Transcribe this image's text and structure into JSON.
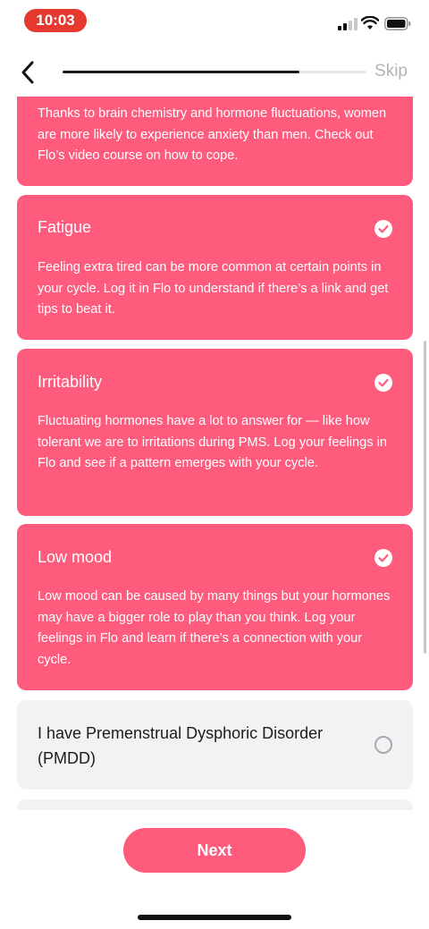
{
  "status_bar": {
    "time": "10:03",
    "icons": [
      "signal-icon",
      "wifi-icon",
      "battery-icon"
    ],
    "time_pill_color": "#e5392f"
  },
  "nav": {
    "back_icon": "back-chevron-icon",
    "skip_label": "Skip",
    "progress": 0.78
  },
  "cards": [
    {
      "title": "",
      "description": "Thanks to brain chemistry and hormone fluctuations, women are more likely to experience anxiety than men. Check out Flo’s video course on how to cope.",
      "selected": true
    },
    {
      "title": "Fatigue",
      "description": "Feeling extra tired can be more common at certain points in your cycle. Log it in Flo to understand if there’s a link and get tips to beat it.",
      "selected": true
    },
    {
      "title": "Irritability",
      "description": "Fluctuating hormones have a lot to answer for — like how tolerant we are to irritations during PMS. Log your feelings in Flo and see if a pattern emerges with your cycle.",
      "selected": true
    },
    {
      "title": "Low mood",
      "description": "Low mood can be caused by many things but your hormones may have a bigger role to play than you think. Log your feelings in Flo and learn if there’s a connection with your cycle.",
      "selected": true
    },
    {
      "title": "I have Premenstrual Dysphoric Disorder (PMDD)",
      "description": "",
      "selected": false
    }
  ],
  "next_label": "Next",
  "colors": {
    "accent": "#ff5b7c",
    "unselected_card": "#f2f2f4",
    "skip_text": "#b3b3b8"
  }
}
